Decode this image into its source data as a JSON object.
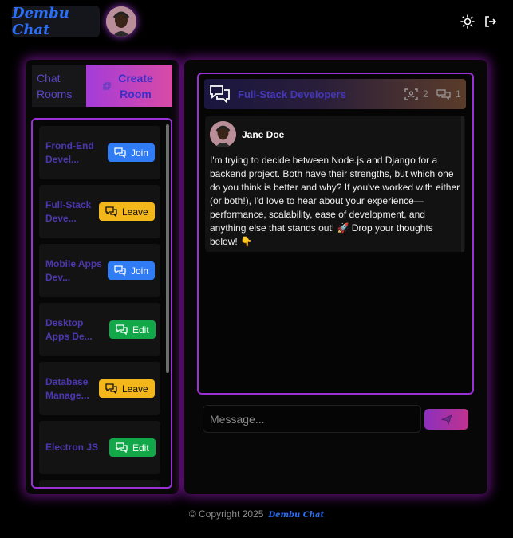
{
  "app": {
    "brand": "Dembu Chat"
  },
  "header": {
    "theme_icon": "sun-icon",
    "logout_icon": "logout-icon"
  },
  "tabs": {
    "chat_rooms": "Chat Rooms",
    "create_room": "Create Room"
  },
  "rooms": [
    {
      "name": "Frond-End Devel...",
      "action": "Join"
    },
    {
      "name": "Full-Stack Deve...",
      "action": "Leave"
    },
    {
      "name": "Mobile Apps Dev...",
      "action": "Join"
    },
    {
      "name": "Desktop Apps De...",
      "action": "Edit"
    },
    {
      "name": "Database Manage...",
      "action": "Leave"
    },
    {
      "name": "Electron JS",
      "action": "Edit"
    }
  ],
  "chat": {
    "title": "Full-Stack Developers",
    "members_count": "2",
    "messages_count": "1",
    "messages": [
      {
        "author": "Jane Doe",
        "text": "I'm trying to decide between Node.js and Django for a backend project. Both have their strengths, but which one do you think is better and why? If you've worked with either (or both!), I'd love to hear about your experience—performance, scalability, ease of development, and anything else that stands out! 🚀 Drop your thoughts below! 👇"
      }
    ]
  },
  "composer": {
    "placeholder": "Message..."
  },
  "footer": {
    "copyright": "© Copyright 2025",
    "brand": "Dembu Chat"
  },
  "colors": {
    "accent_purple": "#9b30d6",
    "brand_blue": "#2b6ff5",
    "join": "#2f7cf5",
    "leave": "#f3b61b",
    "edit": "#12a84a"
  }
}
